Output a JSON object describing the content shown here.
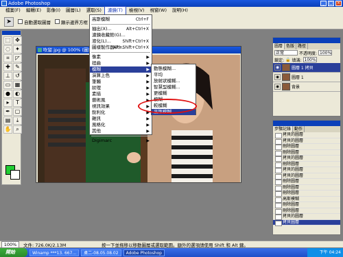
{
  "app": {
    "title": "Adobe Photoshop"
  },
  "menubar": {
    "items": [
      "檔案(F)",
      "編輯(E)",
      "影像(I)",
      "圖層(L)",
      "選取(S)",
      "濾鏡(T)",
      "檢視(V)",
      "視窗(W)",
      "說明(H)"
    ],
    "active_index": 5
  },
  "options": {
    "auto_select": "自動選取圖層",
    "show_bounds": "顯示邊界方框"
  },
  "document": {
    "title": "吹留.jpg @ 100% (圖層 1 拷貝"
  },
  "filter_menu": {
    "items": [
      {
        "label": "高斯模糊",
        "shortcut": "Ctrl+F"
      },
      {
        "label": "抽出(X)...",
        "shortcut": "Alt+Ctrl+X"
      },
      {
        "label": "濾鏡收藏館(G)...",
        "shortcut": ""
      },
      {
        "label": "液化(L)...",
        "shortcut": "Shift+Ctrl+X"
      },
      {
        "label": "圖樣製作器(P)...",
        "shortcut": "Alt+Shift+Ctrl+X"
      },
      {
        "label": "像素",
        "shortcut": ""
      },
      {
        "label": "扭曲",
        "shortcut": ""
      },
      {
        "label": "模糊",
        "shortcut": ""
      },
      {
        "label": "演算上色",
        "shortcut": ""
      },
      {
        "label": "筆觸",
        "shortcut": ""
      },
      {
        "label": "紋理",
        "shortcut": ""
      },
      {
        "label": "素描",
        "shortcut": ""
      },
      {
        "label": "藝術風",
        "shortcut": ""
      },
      {
        "label": "視訊效果",
        "shortcut": ""
      },
      {
        "label": "銳利化",
        "shortcut": ""
      },
      {
        "label": "雜訊",
        "shortcut": ""
      },
      {
        "label": "風格化",
        "shortcut": ""
      },
      {
        "label": "其他",
        "shortcut": ""
      },
      {
        "label": "Digimarc",
        "shortcut": ""
      }
    ]
  },
  "blur_submenu": {
    "items": [
      "動態模糊...",
      "平均",
      "放射狀模糊...",
      "智慧型模糊...",
      "更模糊",
      "模糊",
      "較模糊",
      "高斯模糊..."
    ],
    "selected": "高斯模糊..."
  },
  "layers_panel": {
    "tabs": [
      "圖層",
      "色版",
      "路徑"
    ],
    "blend_mode": "正常",
    "opacity_label": "不透明度:",
    "opacity": "100%",
    "lock_label": "鎖定:",
    "fill_label": "填滿:",
    "fill": "100%",
    "layers": [
      {
        "name": "圖層 1 拷貝",
        "selected": true
      },
      {
        "name": "圖層 1",
        "selected": false
      },
      {
        "name": "背景",
        "selected": false
      }
    ]
  },
  "history_panel": {
    "tabs": [
      "步驟記錄",
      "動作"
    ],
    "items": [
      "拷貝的圖層",
      "拷貝的圖層",
      "刪除圖層",
      "刪除圖層",
      "拷貝的圖層",
      "刪除圖層",
      "拷貝的圖層",
      "拷貝的圖層",
      "刪除圖層",
      "刪除圖層",
      "刪除圖層",
      "高斯模糊",
      "刪除圖層",
      "刪除圖層",
      "拷貝的圖層",
      "拷貝圖層"
    ],
    "selected_index": 15
  },
  "status": {
    "zoom": "100%",
    "doc": "文件: 726.0K/2.13M",
    "hint": "按一下並拖移以移動圖層或選取範圍。額外的選項請使用 Shift 和 Alt 鍵。"
  },
  "taskbar": {
    "start": "開始",
    "tasks": [
      "Winamp ***13. 667...",
      "桌二-08.05.08.02",
      "Adobe Photoshop"
    ],
    "active_index": 2,
    "clock": "下午 04:24"
  },
  "colors": {
    "accent": "#2a3f9a",
    "highlight_circle": "#e01010",
    "foreground": "#22cc33"
  }
}
